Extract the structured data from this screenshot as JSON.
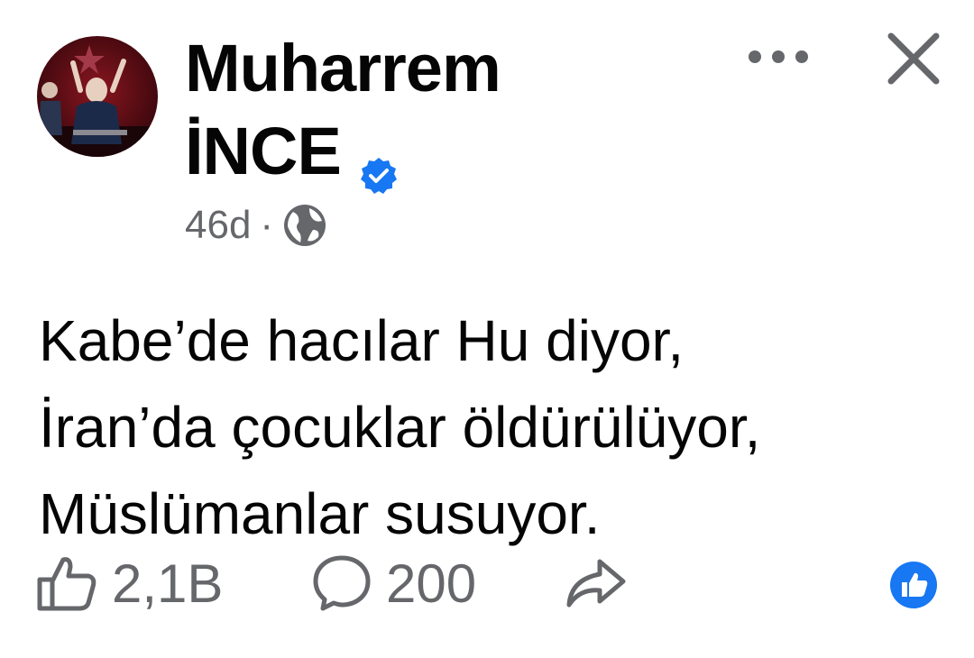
{
  "post": {
    "author_name_line1": "Muharrem",
    "author_name_line2": "İNCE",
    "timestamp": "46d",
    "separator": "·",
    "text_lines": [
      "Kabe’de hacılar Hu diyor,",
      "İran’da çocuklar öldürülüyor,",
      "Müslümanlar susuyor."
    ]
  },
  "actions": {
    "like_count": "2,1B",
    "comment_count": "200"
  },
  "icons": {
    "verified": "verified-badge-icon",
    "privacy": "globe-icon",
    "more": "more-options-icon",
    "close": "close-icon",
    "like": "thumbs-up-icon",
    "comment": "comment-icon",
    "share": "share-icon",
    "reaction": "like-reaction-icon"
  },
  "colors": {
    "brand_blue": "#1877f2",
    "secondary_text": "#65676b",
    "primary_text": "#050505"
  }
}
